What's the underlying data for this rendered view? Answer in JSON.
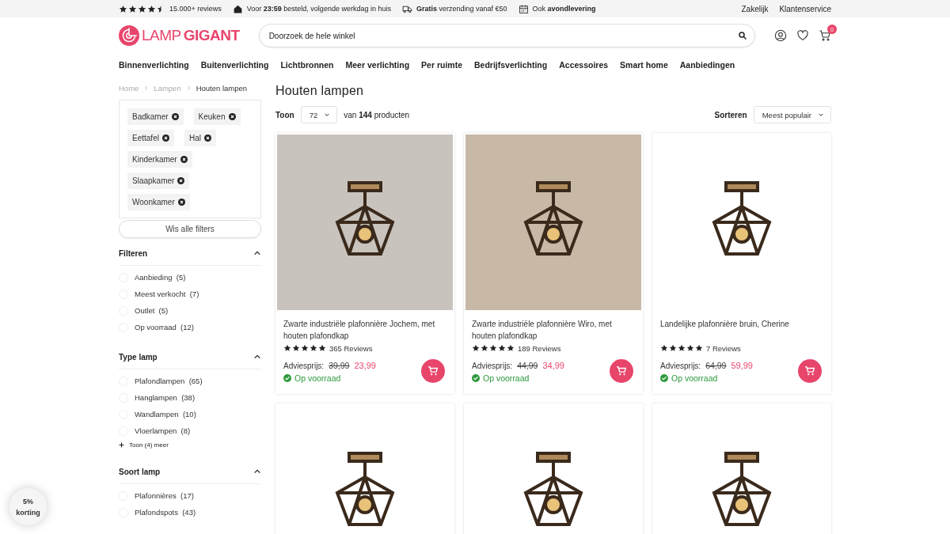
{
  "top_bar": {
    "stars": 4.5,
    "reviews": "15.000+ reviews",
    "usps": [
      {
        "kind": "house",
        "text": "Voor **23:59** besteld, volgende werkdag in huis"
      },
      {
        "kind": "truck",
        "text": "**Gratis** verzending vanaf €50"
      },
      {
        "kind": "calendar",
        "text": "Ook **avondlevering**"
      }
    ],
    "links": [
      "Zakelijk",
      "Klantenservice"
    ]
  },
  "header": {
    "logo_light": "LAMP",
    "logo_bold": "GIGANT",
    "search": {
      "placeholder": "Doorzoek de hele winkel"
    },
    "cart_count": "0"
  },
  "nav": [
    "Binnenverlichting",
    "Buitenverlichting",
    "Lichtbronnen",
    "Meer verlichting",
    "Per ruimte",
    "Bedrijfsverlichting",
    "Accessoires",
    "Smart home",
    "Aanbiedingen"
  ],
  "breadcrumb": [
    {
      "label": "Home",
      "current": false
    },
    {
      "label": "Lampen",
      "current": false
    },
    {
      "label": "Houten lampen",
      "current": true
    }
  ],
  "active_filters": [
    "Badkamer",
    "Keuken",
    "Eettafel",
    "Hal",
    "Kinderkamer",
    "Slaapkamer",
    "Woonkamer"
  ],
  "clear_filters": "Wis alle filters",
  "filter_groups": [
    {
      "title": "Filteren",
      "expanded": true,
      "options": [
        {
          "label": "Aanbieding",
          "count": "(5)",
          "checked": false
        },
        {
          "label": "Meest verkocht",
          "count": "(7)",
          "checked": false
        },
        {
          "label": "Outlet",
          "count": "(5)",
          "checked": false
        },
        {
          "label": "Op voorraad",
          "count": "(12)",
          "checked": false
        }
      ]
    },
    {
      "title": "Type lamp",
      "expanded": true,
      "options": [
        {
          "label": "Plafondlampen",
          "count": "(65)",
          "checked": false
        },
        {
          "label": "Hanglampen",
          "count": "(38)",
          "checked": false
        },
        {
          "label": "Wandlampen",
          "count": "(10)",
          "checked": false
        },
        {
          "label": "Vloerlampen",
          "count": "(8)",
          "checked": false
        }
      ],
      "more": "Toon (4) meer"
    },
    {
      "title": "Soort lamp",
      "expanded": true,
      "options": [
        {
          "label": "Plafonnières",
          "count": "(17)",
          "checked": false
        },
        {
          "label": "Plafondspots",
          "count": "(43)",
          "checked": false
        }
      ]
    }
  ],
  "page_title": "Houten lampen",
  "toolbar": {
    "show_label": "Toon",
    "per_page": "72",
    "count_text": "van **144** producten",
    "sort_label": "Sorteren",
    "sort_value": "Meest populair"
  },
  "products": [
    {
      "kind": "full",
      "name": "Zwarte industriële plafonnière Jochem, met houten plafondkap",
      "stars": 5,
      "reviews": "365 Reviews",
      "price_label": "Adviesprijs:",
      "old_price": "39,99",
      "price": "23,99",
      "stock": "Op voorraad"
    },
    {
      "kind": "full",
      "name": "Zwarte industriële plafonnière Wiro, met houten plafondkap",
      "stars": 5,
      "reviews": "189 Reviews",
      "price_label": "Adviesprijs:",
      "old_price": "44,99",
      "price": "34,99",
      "stock": "Op voorraad"
    },
    {
      "kind": "full",
      "name": "Landelijke plafonnière bruin, Cherine",
      "stars": 5,
      "reviews": "7 Reviews",
      "price_label": "Adviesprijs:",
      "old_price": "64,99",
      "price": "59,99",
      "stock": "Op voorraad"
    },
    {
      "kind": "image_only"
    },
    {
      "kind": "image_only"
    },
    {
      "kind": "image_only"
    }
  ],
  "discount_badge": {
    "line1": "5%",
    "line2": "korting"
  }
}
